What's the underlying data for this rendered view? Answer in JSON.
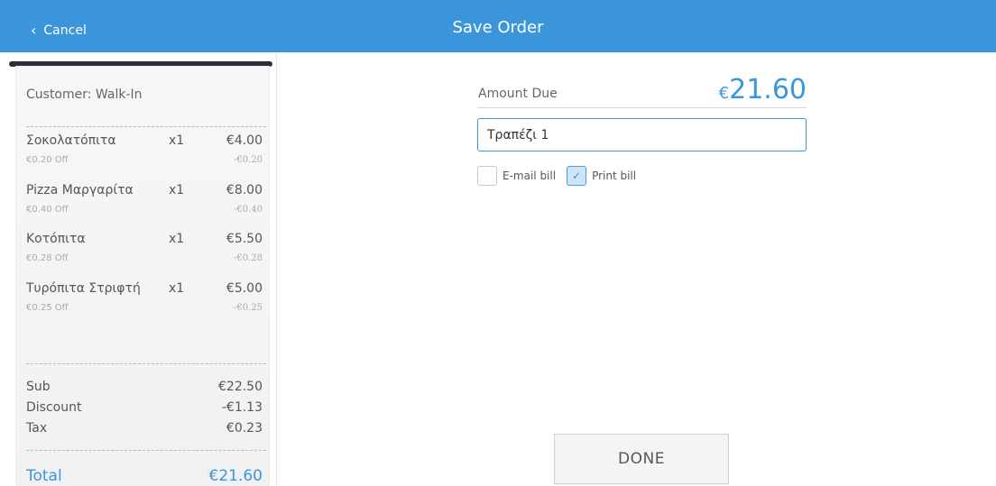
{
  "header": {
    "cancel_label": "Cancel",
    "title": "Save Order"
  },
  "receipt": {
    "customer": "Customer: Walk-In",
    "items": [
      {
        "name": "Σοκολατόπιτα",
        "qty": "x1",
        "price": "€4.00",
        "discount_label": "€0.20 Off",
        "discount_amount": "-€0.20"
      },
      {
        "name": "Pizza Μαργαρίτα",
        "qty": "x1",
        "price": "€8.00",
        "discount_label": "€0.40 Off",
        "discount_amount": "-€0.40"
      },
      {
        "name": "Κοτόπιτα",
        "qty": "x1",
        "price": "€5.50",
        "discount_label": "€0.28 Off",
        "discount_amount": "-€0.28"
      },
      {
        "name": "Τυρόπιτα Στριφτή",
        "qty": "x1",
        "price": "€5.00",
        "discount_label": "€0.25 Off",
        "discount_amount": "-€0.25"
      }
    ],
    "totals": {
      "sub_label": "Sub",
      "sub_value": "€22.50",
      "discount_label": "Discount",
      "discount_value": "-€1.13",
      "tax_label": "Tax",
      "tax_value": "€0.23",
      "total_label": "Total",
      "total_value": "€21.60"
    }
  },
  "order": {
    "amount_label": "Amount Due",
    "amount_currency": "€",
    "amount_value": "21.60",
    "note_value": "Τραπέζι 1",
    "email_bill_label": "E-mail bill",
    "email_bill_checked": false,
    "print_bill_label": "Print bill",
    "print_bill_checked": true,
    "done_label": "DONE"
  },
  "colors": {
    "accent": "#3b95db",
    "header_bg": "#3b95db"
  }
}
